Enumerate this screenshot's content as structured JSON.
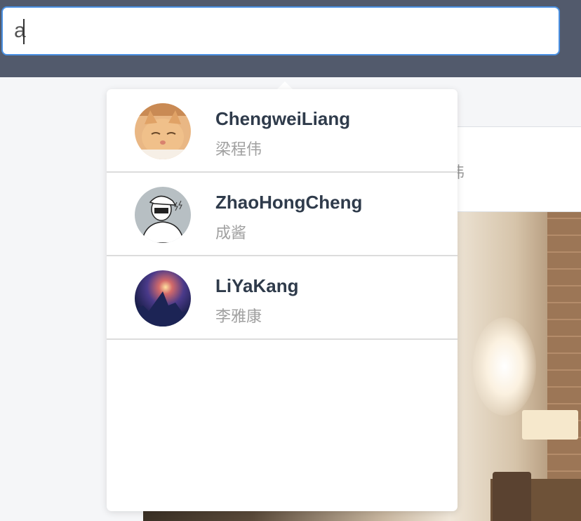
{
  "search": {
    "value": "a",
    "placeholder": ""
  },
  "background": {
    "card_text": "伟"
  },
  "suggestions": [
    {
      "username": "ChengweiLiang",
      "display_name": "梁程伟",
      "avatar": "cat-avatar"
    },
    {
      "username": "ZhaoHongCheng",
      "display_name": "成酱",
      "avatar": "sketch-avatar"
    },
    {
      "username": "LiYaKang",
      "display_name": "李雅康",
      "avatar": "nebula-avatar"
    }
  ],
  "colors": {
    "topbar": "#525a6c",
    "focus_border": "#4a90e2",
    "username": "#2f3b4b",
    "display_name": "#a0a0a0"
  }
}
